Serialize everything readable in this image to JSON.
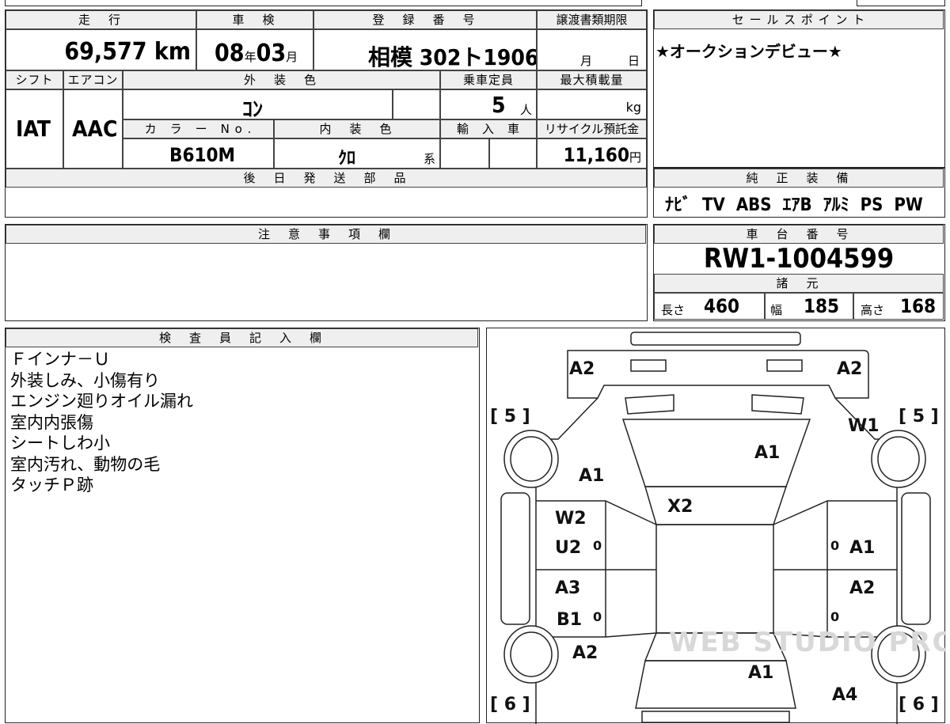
{
  "top_sheet": {
    "mileage": {
      "label": "走　行",
      "value": "69,577",
      "unit": "km"
    },
    "inspection": {
      "label": "車　検",
      "year": "08",
      "year_unit": "年",
      "month": "03",
      "month_unit": "月"
    },
    "registration": {
      "label": "登　録　番　号",
      "value": "相模 302ト1906"
    },
    "transfer_deadline": {
      "label": "譲渡書類期限",
      "month_unit": "月",
      "day_unit": "日"
    },
    "shift": {
      "label": "シフト",
      "value": "IAT"
    },
    "aircon": {
      "label": "エアコン",
      "value": "AAC"
    },
    "exterior_color": {
      "label": "外　装　色",
      "value": "ｺﾝ"
    },
    "capacity": {
      "label": "乗車定員",
      "value": "5",
      "unit": "人"
    },
    "max_load": {
      "label": "最大積載量",
      "unit": "kg"
    },
    "color_no": {
      "label": "カ　ラ　ー　N o .",
      "value": "B610M"
    },
    "interior_color": {
      "label": "内　装　色",
      "value": "ｸﾛ",
      "suffix": "系"
    },
    "import": {
      "label": "輸　入　車"
    },
    "recycle": {
      "label": "リサイクル預託金",
      "value": "11,160",
      "unit": "円"
    },
    "later_parts": {
      "label": "後　日　発　送　部　品"
    }
  },
  "sales_point": {
    "label": "セ ー ル ス ポ イ ン ト",
    "text": "★オークションデビュー★"
  },
  "equipment": {
    "label": "純　正　装　備",
    "items": [
      "ﾅﾋﾞ",
      "TV",
      "ABS",
      "ｴｱB",
      "ｱﾙﾐ",
      "PS",
      "PW"
    ]
  },
  "caution": {
    "label": "注　意　事　項　欄"
  },
  "chassis": {
    "label": "車　台　番　号",
    "value": "RW1-1004599"
  },
  "specs": {
    "label": "諸　元",
    "length_label": "長さ",
    "length": "460",
    "width_label": "幅",
    "width": "185",
    "height_label": "高さ",
    "height": "168"
  },
  "inspector": {
    "label": "検　査　員　記　入　欄",
    "lines": [
      "Ｆインナ－Ｕ",
      "外装しみ、小傷有り",
      "エンジン廻りオイル漏れ",
      "室内内張傷",
      "シートしわ小",
      "室内汚れ、動物の毛",
      "タッチＰ跡"
    ]
  },
  "diagram": {
    "tires": {
      "front_left": "[ 5 ]",
      "front_right": "[ 5 ]",
      "rear_left": "[ 6 ]",
      "rear_right": "[ 6 ]"
    },
    "codes": {
      "bumper_left": "A2",
      "bumper_right": "A2",
      "windshield": "W1",
      "hood": "A1",
      "fender_left": "A1",
      "roof": "X2",
      "door_fl_1": "W2",
      "door_fl_2": "U2",
      "door_fl_zero": "0",
      "door_fr_zero": "0",
      "door_fr_1": "A1",
      "door_rl_1": "A3",
      "door_rl_2": "B1",
      "door_rl_zero": "0",
      "door_rr_1": "A2",
      "door_rr_zero": "0",
      "quarter_left": "A2",
      "trunk": "A1",
      "quarter_right": "A4"
    },
    "watermark": "WEB STUDIO PRO"
  }
}
